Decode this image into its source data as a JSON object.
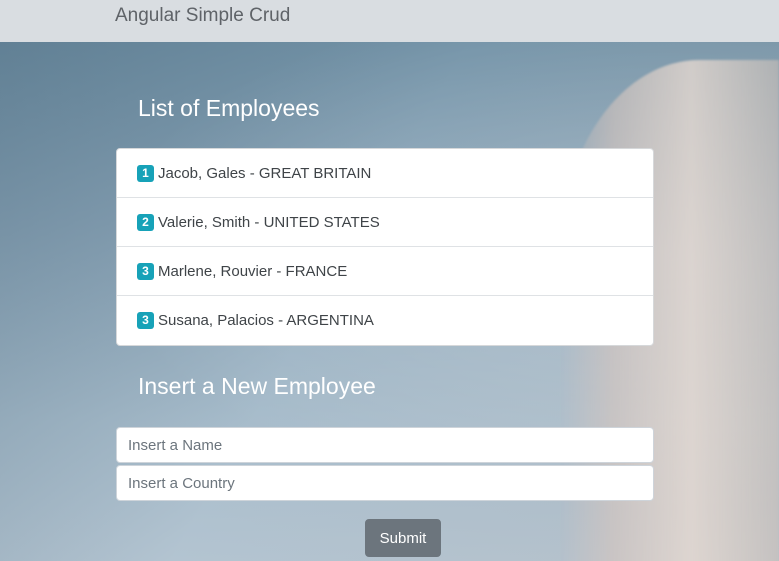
{
  "navbar": {
    "brand": "Angular Simple Crud"
  },
  "list_section": {
    "title": "List of Employees",
    "employees": [
      {
        "badge": "1",
        "text": "Jacob, Gales - GREAT BRITAIN"
      },
      {
        "badge": "2",
        "text": "Valerie, Smith - UNITED STATES"
      },
      {
        "badge": "3",
        "text": "Marlene, Rouvier - FRANCE"
      },
      {
        "badge": "3",
        "text": "Susana, Palacios - ARGENTINA"
      }
    ],
    "badge_color": "#17a2b8"
  },
  "insert_section": {
    "title": "Insert a New Employee",
    "name_placeholder": "Insert a Name",
    "name_value": "",
    "country_placeholder": "Insert a Country",
    "country_value": "",
    "submit_label": "Submit",
    "submit_color": "#6c757d"
  }
}
